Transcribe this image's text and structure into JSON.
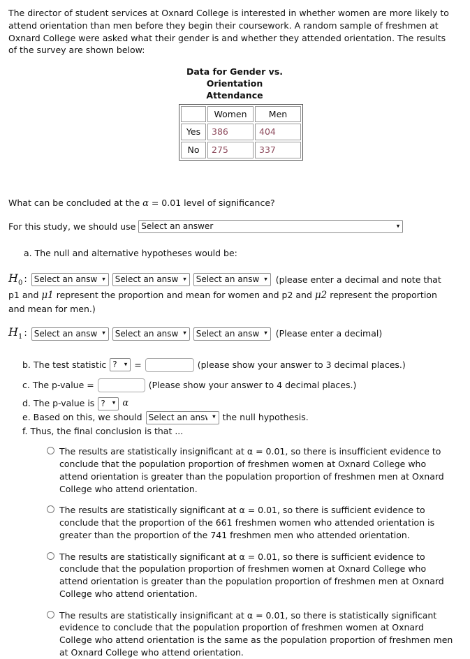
{
  "intro": {
    "paragraph": "The director of student services at Oxnard College is interested in whether women are more likely to attend orientation than men before they begin their coursework.  A random sample of freshmen at Oxnard College were asked what their gender is and whether they attended orientation.  The results of the survey are shown below:"
  },
  "table": {
    "title_line1": "Data for Gender vs.",
    "title_line2": "Orientation",
    "title_line3": "Attendance",
    "corner": "",
    "columns": [
      "Women",
      "Men"
    ],
    "rows": [
      {
        "label": "Yes",
        "women": "386",
        "men": "404"
      },
      {
        "label": "No",
        "women": "275",
        "men": "337"
      }
    ],
    "value_color": "#8d4a5c"
  },
  "question": {
    "alpha_line_pre": "What can be concluded at the ",
    "alpha_symbol": "α",
    "alpha_line_post": " = 0.01 level of significance?",
    "study_label": "For this study, we should use",
    "study_select_value": "Select an answer"
  },
  "part_a": {
    "label": "a. The null and alternative hypotheses would be:",
    "h0_symbol": "H",
    "h0_sub": "0",
    "h1_symbol": "H",
    "h1_sub": "1",
    "colon": ":",
    "select_value": "Select an answer",
    "h0_note": "(please enter a decimal and note that",
    "h0_note_cont_1": "p1 and ",
    "h0_note_mu1": "μ1",
    "h0_note_cont_2": " represent the proportion and mean for women and p2 and ",
    "h0_note_mu2": "μ2",
    "h0_note_cont_3": " represent the proportion and mean for men.)",
    "h1_note": "(Please enter a decimal)"
  },
  "part_b": {
    "label": "b. The test statistic",
    "symbol_select": "?",
    "equals": "=",
    "input_value": "",
    "note": "(please show your answer to 3 decimal places.)"
  },
  "part_c": {
    "label": "c. The p-value =",
    "input_value": "",
    "note": "(Please show your answer to 4 decimal places.)"
  },
  "part_d": {
    "label": "d. The p-value is",
    "comparison_select": "?",
    "alpha_symbol": "α"
  },
  "part_e": {
    "label_pre": "e. Based on this, we should",
    "select_value": "Select an answer",
    "label_post": "the null hypothesis."
  },
  "part_f": {
    "label": "f. Thus, the final conclusion is that ..."
  },
  "options": [
    {
      "id": "option-1",
      "text": "The results are statistically insignificant at α = 0.01, so there is insufficient evidence to conclude that the population proportion of freshmen women at Oxnard College who attend orientation is greater than the population proportion of freshmen men at Oxnard College who attend orientation.",
      "selected": false
    },
    {
      "id": "option-2",
      "text": "The results are statistically significant at α = 0.01, so there is sufficient evidence to conclude that the proportion of the 661 freshmen women who attended orientation is greater than the proportion of the 741 freshmen men who attended orientation.",
      "selected": false
    },
    {
      "id": "option-3",
      "text": "The results are statistically significant at α = 0.01, so there is sufficient evidence to conclude that the population proportion of freshmen women at Oxnard College who attend orientation is greater than the population proportion of freshmen men at Oxnard College who attend orientation.",
      "selected": false
    },
    {
      "id": "option-4",
      "text": "The results are statistically insignificant at α = 0.01, so there is statistically significant evidence to conclude that the population proportion of freshmen women at Oxnard College who attend orientation is the same as the population proportion of freshmen men at Oxnard College who attend orientation.",
      "selected": false
    }
  ],
  "icons": {
    "chevron": "▾"
  }
}
